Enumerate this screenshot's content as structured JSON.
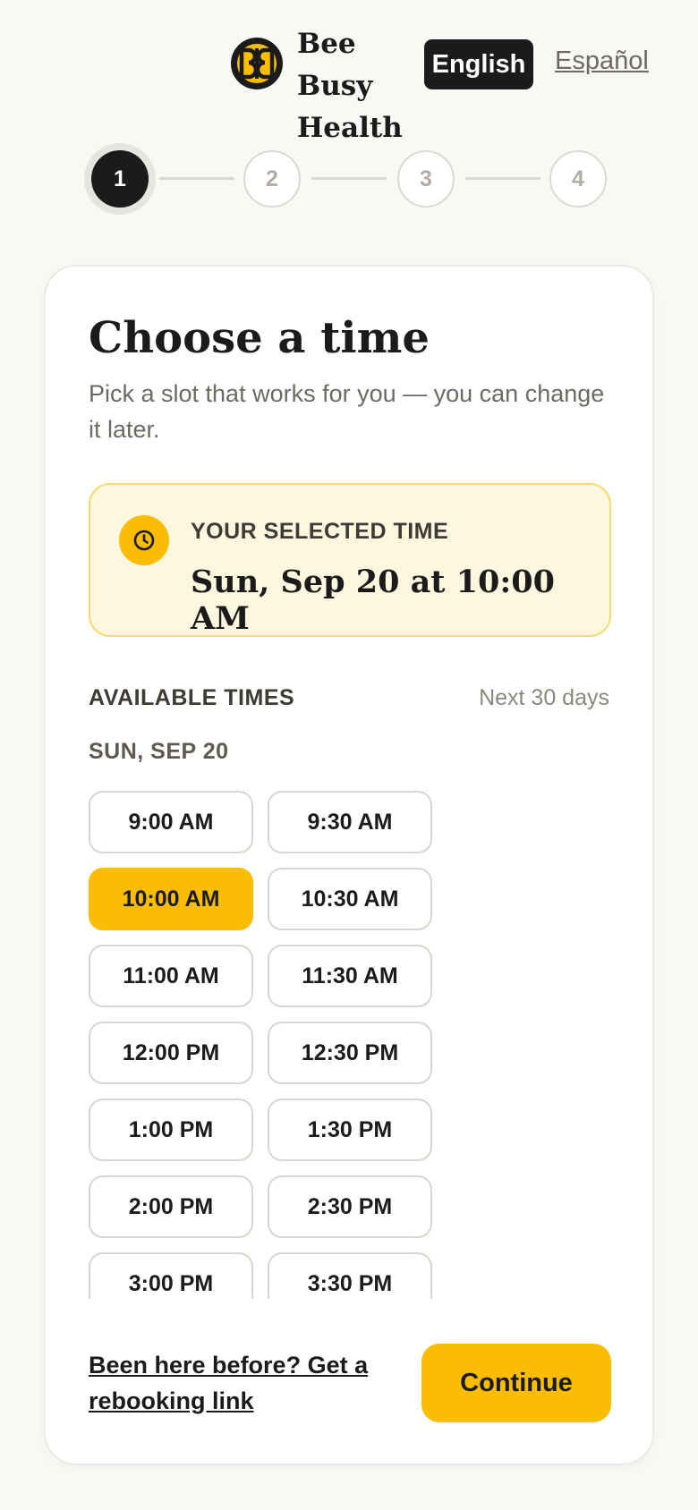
{
  "header": {
    "brand_line1": "Bee Busy",
    "brand_line2": "Health",
    "lang_active": "English",
    "lang_alt": "Español"
  },
  "stepper": {
    "current": 1,
    "steps": [
      "1",
      "2",
      "3",
      "4"
    ]
  },
  "card": {
    "title": "Choose a time",
    "subtitle": "Pick a slot that works for you — you can change it later.",
    "selected": {
      "label": "YOUR SELECTED TIME",
      "value": "Sun, Sep 20 at 10:00 AM"
    },
    "available_label": "AVAILABLE TIMES",
    "available_range": "Next 30 days",
    "day_label": "SUN, SEP 20",
    "slots": [
      {
        "time": "9:00 AM",
        "selected": false
      },
      {
        "time": "9:30 AM",
        "selected": false
      },
      {
        "time": "10:00 AM",
        "selected": true
      },
      {
        "time": "10:30 AM",
        "selected": false
      },
      {
        "time": "11:00 AM",
        "selected": false
      },
      {
        "time": "11:30 AM",
        "selected": false
      },
      {
        "time": "12:00 PM",
        "selected": false
      },
      {
        "time": "12:30 PM",
        "selected": false
      },
      {
        "time": "1:00 PM",
        "selected": false
      },
      {
        "time": "1:30 PM",
        "selected": false
      },
      {
        "time": "2:00 PM",
        "selected": false
      },
      {
        "time": "2:30 PM",
        "selected": false
      },
      {
        "time": "3:00 PM",
        "selected": false
      },
      {
        "time": "3:30 PM",
        "selected": false
      }
    ],
    "rebook_link": "Been here before? Get a rebooking link",
    "continue_label": "Continue"
  },
  "colors": {
    "accent": "#fbbc04",
    "dark": "#1b1b1b",
    "selected_bg": "#fef7e0",
    "page_bg": "#f9f8f5"
  },
  "icons": {
    "logo": "bee-busy-logo-icon",
    "clock": "clock-icon"
  }
}
